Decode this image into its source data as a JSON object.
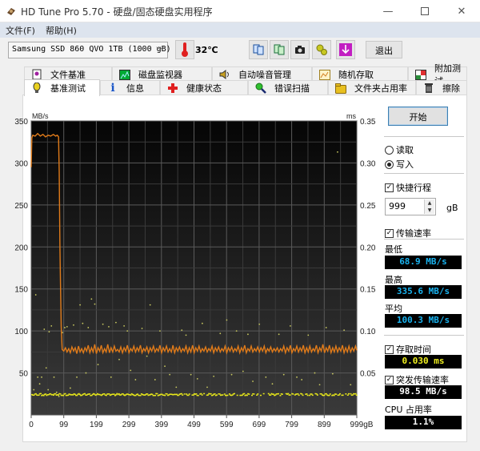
{
  "window": {
    "title": "HD Tune Pro 5.70 - 硬盘/固态硬盘实用程序",
    "controls": [
      "minimize",
      "maximize",
      "close"
    ]
  },
  "menu": [
    {
      "label": "文件(F)"
    },
    {
      "label": "帮助(H)"
    }
  ],
  "toolbar": {
    "drive_selected": "Samsung SSD 860 QVO 1TB (1000 gB)",
    "temperature": "32℃",
    "buttons": [
      {
        "icon": "copy-info-icon"
      },
      {
        "icon": "copy-all-icon"
      },
      {
        "icon": "screenshot-camera-icon"
      },
      {
        "icon": "options-gears-icon"
      },
      {
        "icon": "download-arrow-icon"
      }
    ],
    "exit_label": "退出"
  },
  "tabs": {
    "top_row": [
      {
        "label": "文件基准",
        "icon": "file-benchmark-icon"
      },
      {
        "label": "磁盘监视器",
        "icon": "disk-monitor-icon"
      },
      {
        "label": "自动噪音管理",
        "icon": "speaker-icon"
      },
      {
        "label": "随机存取",
        "icon": "random-access-icon"
      },
      {
        "label": "附加测试",
        "icon": "extra-tests-icon"
      }
    ],
    "bottom_row": [
      {
        "label": "基准测试",
        "icon": "benchmark-bulb-icon",
        "active": true
      },
      {
        "label": "信息",
        "icon": "info-icon"
      },
      {
        "label": "健康状态",
        "icon": "health-cross-icon"
      },
      {
        "label": "错误扫描",
        "icon": "magnifier-icon"
      },
      {
        "label": "文件夹占用率",
        "icon": "folder-icon"
      },
      {
        "label": "擦除",
        "icon": "trash-icon"
      }
    ]
  },
  "controls": {
    "start_label": "开始",
    "mode_options": [
      {
        "label": "读取",
        "selected": false
      },
      {
        "label": "写入",
        "selected": true
      }
    ],
    "short_stroke": {
      "label": "快捷行程",
      "checked": true,
      "value": "999",
      "unit": "gB"
    },
    "transfer_rate": {
      "label": "传输速率",
      "checked": true
    },
    "min": {
      "label": "最低",
      "value": "68.9 MB/s"
    },
    "max": {
      "label": "最高",
      "value": "335.6 MB/s"
    },
    "avg": {
      "label": "平均",
      "value": "100.3 MB/s"
    },
    "access_time": {
      "label": "存取时间",
      "checked": true,
      "value": "0.030 ms"
    },
    "burst_rate": {
      "label": "突发传输速率",
      "checked": true,
      "value": "98.5 MB/s"
    },
    "cpu": {
      "label": "CPU 占用率",
      "value": "1.1%"
    }
  },
  "colors": {
    "transfer_line": "#e07b1a",
    "access_dots": "#e8e81a",
    "readout_blue": "#19b3f0",
    "readout_yellow": "#f0f020",
    "readout_white": "#ffffff",
    "chart_bg": "#1a1a1a"
  },
  "chart_data": {
    "type": "line",
    "title": "",
    "xlabel": "gB",
    "ylabel": "MB/s",
    "y2label": "ms",
    "xlim": [
      0,
      999
    ],
    "ylim": [
      0,
      350
    ],
    "y2lim": [
      0,
      0.35
    ],
    "x_ticks": [
      "0",
      "99",
      "199",
      "299",
      "399",
      "499",
      "599",
      "699",
      "799",
      "899",
      "999gB"
    ],
    "y_ticks": [
      "350",
      "300",
      "250",
      "200",
      "150",
      "100",
      "50"
    ],
    "y2_ticks": [
      "0.35",
      "0.30",
      "0.25",
      "0.20",
      "0.15",
      "0.10",
      "0.05"
    ],
    "grid": true,
    "series": [
      {
        "name": "transfer_rate",
        "unit": "MB/s",
        "points": [
          [
            0,
            295
          ],
          [
            2,
            330
          ],
          [
            5,
            333
          ],
          [
            12,
            332
          ],
          [
            20,
            335
          ],
          [
            28,
            332
          ],
          [
            36,
            334
          ],
          [
            44,
            331
          ],
          [
            52,
            333
          ],
          [
            60,
            332
          ],
          [
            68,
            334
          ],
          [
            75,
            332
          ],
          [
            80,
            333
          ],
          [
            84,
            331
          ],
          [
            86,
            290
          ],
          [
            88,
            200
          ],
          [
            90,
            150
          ],
          [
            92,
            105
          ],
          [
            95,
            78
          ],
          [
            100,
            76
          ],
          [
            105,
            80
          ],
          [
            110,
            75
          ],
          [
            115,
            79
          ],
          [
            120,
            74
          ],
          [
            125,
            81
          ],
          [
            130,
            76
          ],
          [
            135,
            80
          ],
          [
            140,
            73
          ],
          [
            145,
            82
          ],
          [
            150,
            75
          ],
          [
            155,
            79
          ],
          [
            160,
            74
          ],
          [
            165,
            80
          ],
          [
            170,
            76
          ],
          [
            175,
            83
          ],
          [
            180,
            74
          ],
          [
            185,
            80
          ],
          [
            190,
            75
          ],
          [
            195,
            84
          ],
          [
            200,
            73
          ],
          [
            205,
            80
          ],
          [
            210,
            76
          ],
          [
            215,
            83
          ],
          [
            220,
            74
          ],
          [
            225,
            79
          ],
          [
            230,
            75
          ],
          [
            235,
            84
          ],
          [
            240,
            74
          ],
          [
            245,
            80
          ],
          [
            250,
            75
          ],
          [
            255,
            82
          ],
          [
            260,
            76
          ],
          [
            265,
            78
          ],
          [
            270,
            75
          ],
          [
            275,
            81
          ],
          [
            280,
            74
          ],
          [
            285,
            80
          ],
          [
            290,
            76
          ],
          [
            295,
            83
          ],
          [
            300,
            74
          ],
          [
            305,
            79
          ],
          [
            310,
            76
          ],
          [
            315,
            82
          ],
          [
            320,
            75
          ],
          [
            325,
            80
          ],
          [
            330,
            76
          ],
          [
            335,
            83
          ],
          [
            340,
            74
          ],
          [
            345,
            79
          ],
          [
            350,
            76
          ],
          [
            355,
            81
          ],
          [
            360,
            74
          ],
          [
            365,
            80
          ],
          [
            370,
            76
          ],
          [
            375,
            82
          ],
          [
            380,
            75
          ],
          [
            385,
            79
          ],
          [
            390,
            76
          ],
          [
            395,
            83
          ],
          [
            400,
            74
          ],
          [
            405,
            80
          ],
          [
            410,
            76
          ],
          [
            415,
            82
          ],
          [
            420,
            75
          ],
          [
            425,
            79
          ],
          [
            430,
            75
          ],
          [
            435,
            83
          ],
          [
            440,
            74
          ],
          [
            445,
            80
          ],
          [
            450,
            76
          ],
          [
            455,
            81
          ],
          [
            460,
            75
          ],
          [
            465,
            79
          ],
          [
            470,
            76
          ],
          [
            475,
            82
          ],
          [
            480,
            74
          ],
          [
            485,
            80
          ],
          [
            490,
            75
          ],
          [
            495,
            83
          ],
          [
            500,
            74
          ],
          [
            505,
            80
          ],
          [
            510,
            76
          ],
          [
            515,
            82
          ],
          [
            520,
            75
          ],
          [
            525,
            79
          ],
          [
            530,
            76
          ],
          [
            535,
            81
          ],
          [
            540,
            75
          ],
          [
            545,
            79
          ],
          [
            550,
            76
          ],
          [
            555,
            82
          ],
          [
            560,
            74
          ],
          [
            565,
            80
          ],
          [
            570,
            76
          ],
          [
            575,
            81
          ],
          [
            580,
            75
          ],
          [
            585,
            79
          ],
          [
            590,
            76
          ],
          [
            595,
            82
          ],
          [
            600,
            74
          ],
          [
            605,
            80
          ],
          [
            610,
            76
          ],
          [
            615,
            81
          ],
          [
            620,
            75
          ],
          [
            625,
            79
          ],
          [
            630,
            76
          ],
          [
            635,
            82
          ],
          [
            640,
            74
          ],
          [
            645,
            80
          ],
          [
            650,
            76
          ],
          [
            655,
            83
          ],
          [
            660,
            74
          ],
          [
            665,
            79
          ],
          [
            670,
            76
          ],
          [
            675,
            82
          ],
          [
            680,
            75
          ],
          [
            685,
            79
          ],
          [
            690,
            76
          ],
          [
            695,
            81
          ],
          [
            700,
            75
          ],
          [
            705,
            80
          ],
          [
            710,
            76
          ],
          [
            715,
            82
          ],
          [
            720,
            74
          ],
          [
            725,
            79
          ],
          [
            730,
            76
          ],
          [
            735,
            81
          ],
          [
            740,
            75
          ],
          [
            745,
            79
          ],
          [
            750,
            76
          ],
          [
            755,
            80
          ],
          [
            760,
            75
          ],
          [
            765,
            79
          ],
          [
            770,
            76
          ],
          [
            775,
            82
          ],
          [
            780,
            74
          ],
          [
            785,
            80
          ],
          [
            790,
            76
          ],
          [
            795,
            83
          ],
          [
            800,
            74
          ],
          [
            805,
            79
          ],
          [
            810,
            76
          ],
          [
            815,
            82
          ],
          [
            820,
            75
          ],
          [
            825,
            80
          ],
          [
            830,
            76
          ],
          [
            835,
            83
          ],
          [
            840,
            74
          ],
          [
            845,
            80
          ],
          [
            850,
            75
          ],
          [
            855,
            82
          ],
          [
            860,
            75
          ],
          [
            865,
            79
          ],
          [
            870,
            76
          ],
          [
            875,
            83
          ],
          [
            880,
            74
          ],
          [
            885,
            80
          ],
          [
            890,
            76
          ],
          [
            895,
            84
          ],
          [
            900,
            74
          ],
          [
            905,
            80
          ],
          [
            910,
            76
          ],
          [
            915,
            83
          ],
          [
            920,
            74
          ],
          [
            925,
            80
          ],
          [
            930,
            75
          ],
          [
            935,
            82
          ],
          [
            940,
            75
          ],
          [
            945,
            80
          ],
          [
            950,
            76
          ],
          [
            955,
            83
          ],
          [
            960,
            74
          ],
          [
            965,
            80
          ],
          [
            970,
            75
          ],
          [
            975,
            82
          ],
          [
            980,
            75
          ],
          [
            985,
            80
          ],
          [
            990,
            76
          ],
          [
            995,
            82
          ],
          [
            999,
            77
          ]
        ]
      },
      {
        "name": "access_time",
        "unit": "ms",
        "baseline": 0.024,
        "scatter": [
          [
            8,
            0.03
          ],
          [
            14,
            0.143
          ],
          [
            20,
            0.045
          ],
          [
            26,
            0.037
          ],
          [
            32,
            0.045
          ],
          [
            40,
            0.102
          ],
          [
            46,
            0.056
          ],
          [
            52,
            0.03
          ],
          [
            55,
            0.099
          ],
          [
            62,
            0.106
          ],
          [
            70,
            0.045
          ],
          [
            78,
            0.027
          ],
          [
            85,
            0.022
          ],
          [
            96,
            0.098
          ],
          [
            103,
            0.104
          ],
          [
            110,
            0.105
          ],
          [
            120,
            0.032
          ],
          [
            130,
            0.107
          ],
          [
            140,
            0.045
          ],
          [
            150,
            0.131
          ],
          [
            158,
            0.109
          ],
          [
            168,
            0.05
          ],
          [
            175,
            0.104
          ],
          [
            185,
            0.138
          ],
          [
            195,
            0.132
          ],
          [
            205,
            0.06
          ],
          [
            220,
            0.108
          ],
          [
            238,
            0.105
          ],
          [
            245,
            0.045
          ],
          [
            260,
            0.11
          ],
          [
            270,
            0.066
          ],
          [
            285,
            0.106
          ],
          [
            295,
            0.1
          ],
          [
            305,
            0.053
          ],
          [
            320,
            0.042
          ],
          [
            340,
            0.103
          ],
          [
            355,
            0.07
          ],
          [
            365,
            0.131
          ],
          [
            380,
            0.042
          ],
          [
            395,
            0.1
          ],
          [
            410,
            0.058
          ],
          [
            425,
            0.048
          ],
          [
            445,
            0.033
          ],
          [
            462,
            0.101
          ],
          [
            475,
            0.095
          ],
          [
            490,
            0.048
          ],
          [
            510,
            0.043
          ],
          [
            525,
            0.109
          ],
          [
            540,
            0.033
          ],
          [
            560,
            0.046
          ],
          [
            580,
            0.097
          ],
          [
            600,
            0.113
          ],
          [
            615,
            0.048
          ],
          [
            630,
            0.1
          ],
          [
            650,
            0.052
          ],
          [
            665,
            0.096
          ],
          [
            680,
            0.04
          ],
          [
            700,
            0.108
          ],
          [
            720,
            0.045
          ],
          [
            740,
            0.037
          ],
          [
            760,
            0.096
          ],
          [
            775,
            0.048
          ],
          [
            795,
            0.106
          ],
          [
            815,
            0.045
          ],
          [
            830,
            0.042
          ],
          [
            850,
            0.095
          ],
          [
            870,
            0.05
          ],
          [
            885,
            0.036
          ],
          [
            905,
            0.104
          ],
          [
            925,
            0.049
          ],
          [
            940,
            0.313
          ],
          [
            960,
            0.101
          ],
          [
            980,
            0.036
          ]
        ]
      }
    ],
    "legend": "none"
  }
}
